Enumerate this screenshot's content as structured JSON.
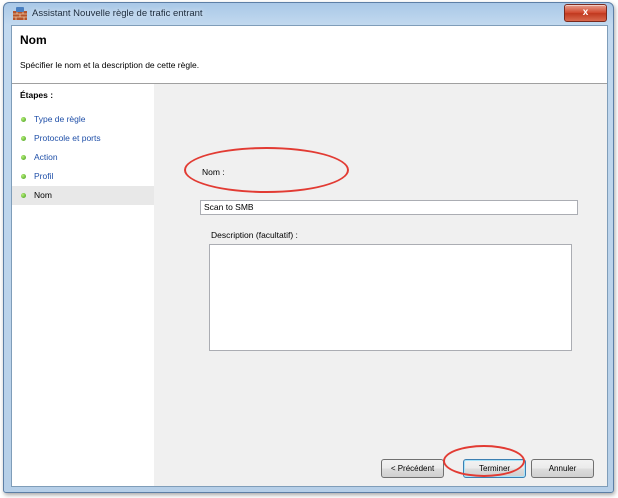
{
  "window": {
    "title": "Assistant Nouvelle règle de trafic entrant",
    "close_label": "x"
  },
  "header": {
    "title": "Nom",
    "subtitle": "Spécifier le nom et la description de cette règle."
  },
  "steps": {
    "title": "Étapes :",
    "items": [
      {
        "label": "Type de règle"
      },
      {
        "label": "Protocole et ports"
      },
      {
        "label": "Action"
      },
      {
        "label": "Profil"
      },
      {
        "label": "Nom"
      }
    ],
    "current_index": 4
  },
  "form": {
    "name_label": "Nom :",
    "name_value": "Scan to SMB",
    "description_label": "Description (facultatif) :",
    "description_value": ""
  },
  "buttons": {
    "previous": "< Précédent",
    "finish": "Terminer",
    "cancel": "Annuler"
  },
  "colors": {
    "annotation": "#e23b33",
    "step_dot": "#3e9a17",
    "link": "#1f4fa8"
  }
}
